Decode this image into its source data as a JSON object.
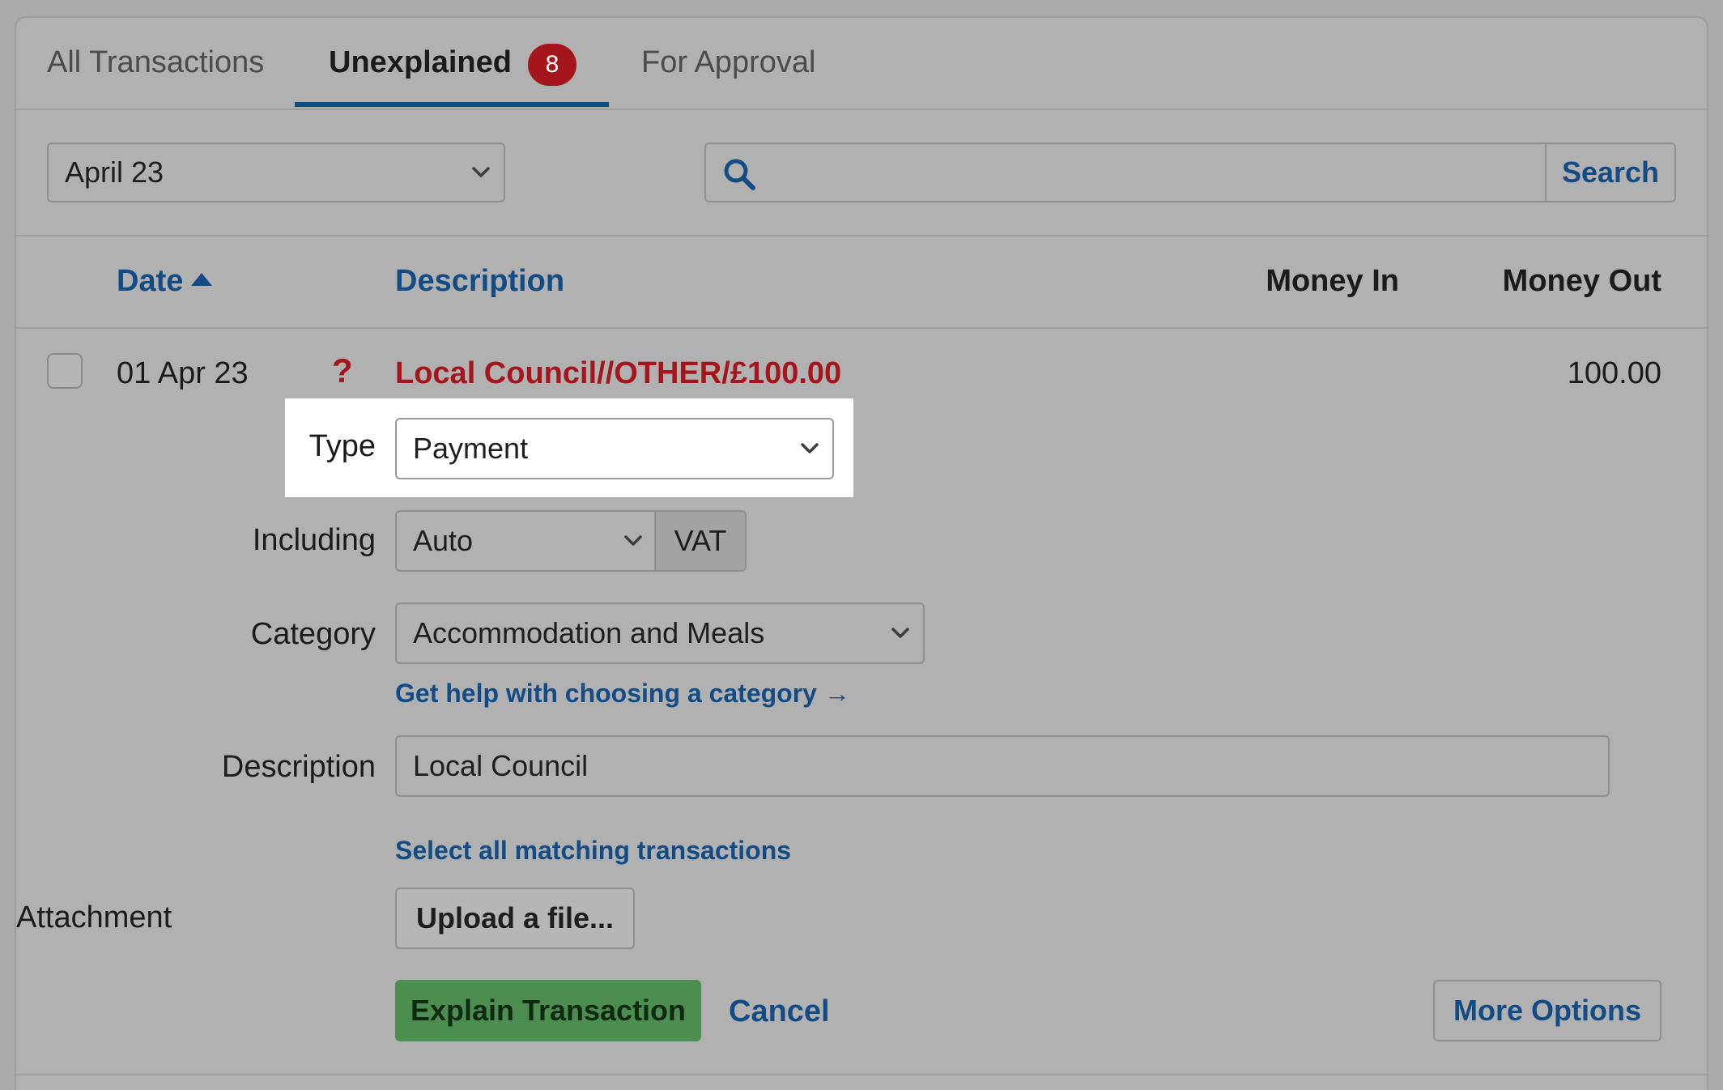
{
  "tabs": {
    "all_label": "All Transactions",
    "unexplained_label": "Unexplained",
    "unexplained_count": "8",
    "approval_label": "For Approval"
  },
  "filters": {
    "month_value": "April 23",
    "search_placeholder": "",
    "search_button": "Search"
  },
  "table": {
    "headers": {
      "date": "Date",
      "description": "Description",
      "money_in": "Money In",
      "money_out": "Money Out"
    },
    "row": {
      "date": "01 Apr 23",
      "status_icon": "?",
      "description": "Local Council//OTHER/£100.00",
      "money_in": "",
      "money_out": "100.00"
    }
  },
  "form": {
    "type_label": "Type",
    "type_value": "Payment",
    "including_label": "Including",
    "including_value": "Auto",
    "vat_addon": "VAT",
    "category_label": "Category",
    "category_value": "Accommodation and Meals",
    "category_help_link": "Get help with choosing a category →",
    "description_label": "Description",
    "description_value": "Local Council",
    "match_link": "Select all matching transactions",
    "attachment_label": "Attachment",
    "upload_button": "Upload a file...",
    "explain_button": "Explain Transaction",
    "cancel_link": "Cancel",
    "more_options_button": "More Options"
  },
  "colors": {
    "brand_blue": "#134c85",
    "alert_red": "#a5151c",
    "success_green": "#4b8e4f",
    "overlay_gray": "#b1b1b1"
  }
}
